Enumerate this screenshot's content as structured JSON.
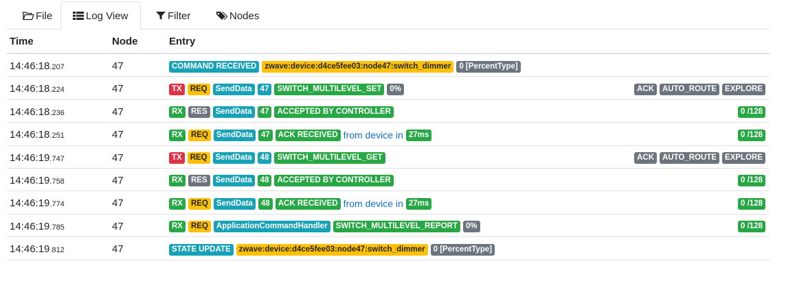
{
  "tabs": [
    {
      "label": "File",
      "icon": "folder-open-icon"
    },
    {
      "label": "Log View",
      "icon": "list-icon",
      "active": true
    },
    {
      "label": "Filter",
      "icon": "filter-icon"
    },
    {
      "label": "Nodes",
      "icon": "tags-icon"
    }
  ],
  "headers": {
    "time": "Time",
    "node": "Node",
    "entry": "Entry"
  },
  "rows": [
    {
      "time": "14:46:18",
      "ms": ".207",
      "node": "47",
      "left": [
        {
          "text": "COMMAND RECEIVED",
          "color": "info"
        },
        {
          "text": "zwave:device:d4ce5fee03:node47:switch_dimmer",
          "color": "warning"
        },
        {
          "text": "0 [PercentType]",
          "color": "secondary"
        }
      ],
      "right": []
    },
    {
      "time": "14:46:18",
      "ms": ".224",
      "node": "47",
      "left": [
        {
          "text": "TX",
          "color": "danger"
        },
        {
          "text": "REQ",
          "color": "warning"
        },
        {
          "text": "SendData",
          "color": "info"
        },
        {
          "text": "47",
          "color": "info"
        },
        {
          "text": "SWITCH_MULTILEVEL_SET",
          "color": "success"
        },
        {
          "text": "0%",
          "color": "secondary"
        }
      ],
      "right": [
        {
          "text": "ACK",
          "color": "secondary"
        },
        {
          "text": "AUTO_ROUTE",
          "color": "secondary"
        },
        {
          "text": "EXPLORE",
          "color": "secondary"
        }
      ]
    },
    {
      "time": "14:46:18",
      "ms": ".236",
      "node": "47",
      "left": [
        {
          "text": "RX",
          "color": "success"
        },
        {
          "text": "RES",
          "color": "secondary"
        },
        {
          "text": "SendData",
          "color": "info"
        },
        {
          "text": "47",
          "color": "success"
        },
        {
          "text": "ACCEPTED BY CONTROLLER",
          "color": "success"
        }
      ],
      "right": [
        {
          "text": "0 /128",
          "color": "success"
        }
      ]
    },
    {
      "time": "14:46:18",
      "ms": ".251",
      "node": "47",
      "left": [
        {
          "text": "RX",
          "color": "success"
        },
        {
          "text": "REQ",
          "color": "warning"
        },
        {
          "text": "SendData",
          "color": "info"
        },
        {
          "text": "47",
          "color": "success"
        },
        {
          "text": "ACK RECEIVED",
          "color": "success"
        },
        {
          "text": "from device in",
          "color": "plain"
        },
        {
          "text": "27ms",
          "color": "success"
        }
      ],
      "right": [
        {
          "text": "0 /128",
          "color": "success"
        }
      ]
    },
    {
      "time": "14:46:19",
      "ms": ".747",
      "node": "47",
      "left": [
        {
          "text": "TX",
          "color": "danger"
        },
        {
          "text": "REQ",
          "color": "warning"
        },
        {
          "text": "SendData",
          "color": "info"
        },
        {
          "text": "48",
          "color": "info"
        },
        {
          "text": "SWITCH_MULTILEVEL_GET",
          "color": "success"
        }
      ],
      "right": [
        {
          "text": "ACK",
          "color": "secondary"
        },
        {
          "text": "AUTO_ROUTE",
          "color": "secondary"
        },
        {
          "text": "EXPLORE",
          "color": "secondary"
        }
      ]
    },
    {
      "time": "14:46:19",
      "ms": ".758",
      "node": "47",
      "left": [
        {
          "text": "RX",
          "color": "success"
        },
        {
          "text": "RES",
          "color": "secondary"
        },
        {
          "text": "SendData",
          "color": "info"
        },
        {
          "text": "48",
          "color": "success"
        },
        {
          "text": "ACCEPTED BY CONTROLLER",
          "color": "success"
        }
      ],
      "right": [
        {
          "text": "0 /128",
          "color": "success"
        }
      ]
    },
    {
      "time": "14:46:19",
      "ms": ".774",
      "node": "47",
      "left": [
        {
          "text": "RX",
          "color": "success"
        },
        {
          "text": "REQ",
          "color": "warning"
        },
        {
          "text": "SendData",
          "color": "info"
        },
        {
          "text": "48",
          "color": "success"
        },
        {
          "text": "ACK RECEIVED",
          "color": "success"
        },
        {
          "text": "from device in",
          "color": "plain"
        },
        {
          "text": "27ms",
          "color": "success"
        }
      ],
      "right": [
        {
          "text": "0 /128",
          "color": "success"
        }
      ]
    },
    {
      "time": "14:46:19",
      "ms": ".785",
      "node": "47",
      "left": [
        {
          "text": "RX",
          "color": "success"
        },
        {
          "text": "REQ",
          "color": "warning"
        },
        {
          "text": "ApplicationCommandHandler",
          "color": "info"
        },
        {
          "text": "SWITCH_MULTILEVEL_REPORT",
          "color": "success"
        },
        {
          "text": "0%",
          "color": "secondary"
        }
      ],
      "right": [
        {
          "text": "0 /128",
          "color": "success"
        }
      ]
    },
    {
      "time": "14:46:19",
      "ms": ".812",
      "node": "47",
      "left": [
        {
          "text": "STATE UPDATE",
          "color": "info"
        },
        {
          "text": "zwave:device:d4ce5fee03:node47:switch_dimmer",
          "color": "warning"
        },
        {
          "text": "0 [PercentType]",
          "color": "secondary"
        }
      ],
      "right": []
    }
  ]
}
